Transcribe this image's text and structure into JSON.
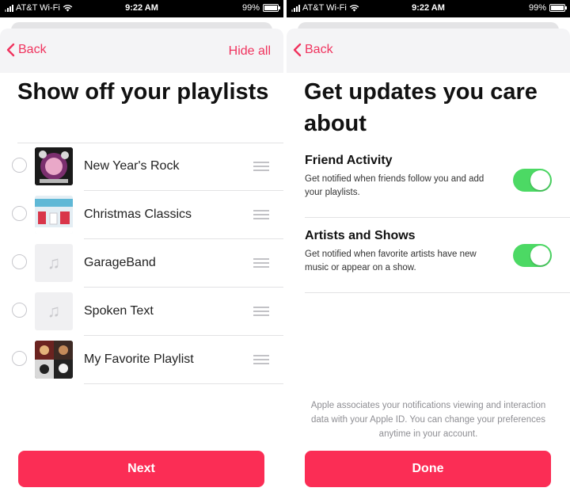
{
  "colors": {
    "accent": "#f0335e",
    "button": "#fb2d55",
    "toggle_on": "#4cd964",
    "status_bar": "#000000"
  },
  "status_bar": {
    "carrier": "AT&T Wi-Fi",
    "time": "9:22 AM",
    "battery": "99%"
  },
  "playlists_screen": {
    "back_label": "Back",
    "hide_all_label": "Hide all",
    "title": "Show off your playlists",
    "playlists": [
      {
        "name": "New Year's Rock",
        "artwork": "new-years-rock-artwork",
        "selected": false
      },
      {
        "name": "Christmas Classics",
        "artwork": "christmas-classics-artwork",
        "selected": false
      },
      {
        "name": "GarageBand",
        "artwork": "music-note-placeholder",
        "selected": false
      },
      {
        "name": "Spoken Text",
        "artwork": "music-note-placeholder",
        "selected": false
      },
      {
        "name": "My Favorite Playlist",
        "artwork": "my-favorite-playlist-artwork",
        "selected": false
      }
    ],
    "next_label": "Next"
  },
  "updates_screen": {
    "back_label": "Back",
    "title": "Get updates you care about",
    "settings": [
      {
        "title": "Friend Activity",
        "description": "Get notified when friends follow you and add your playlists.",
        "enabled": true
      },
      {
        "title": "Artists and Shows",
        "description": "Get notified when favorite artists have new music or appear on a show.",
        "enabled": true
      }
    ],
    "footnote": "Apple associates your notifications viewing and interaction data with your Apple ID. You can change your preferences anytime in your account.",
    "done_label": "Done"
  }
}
